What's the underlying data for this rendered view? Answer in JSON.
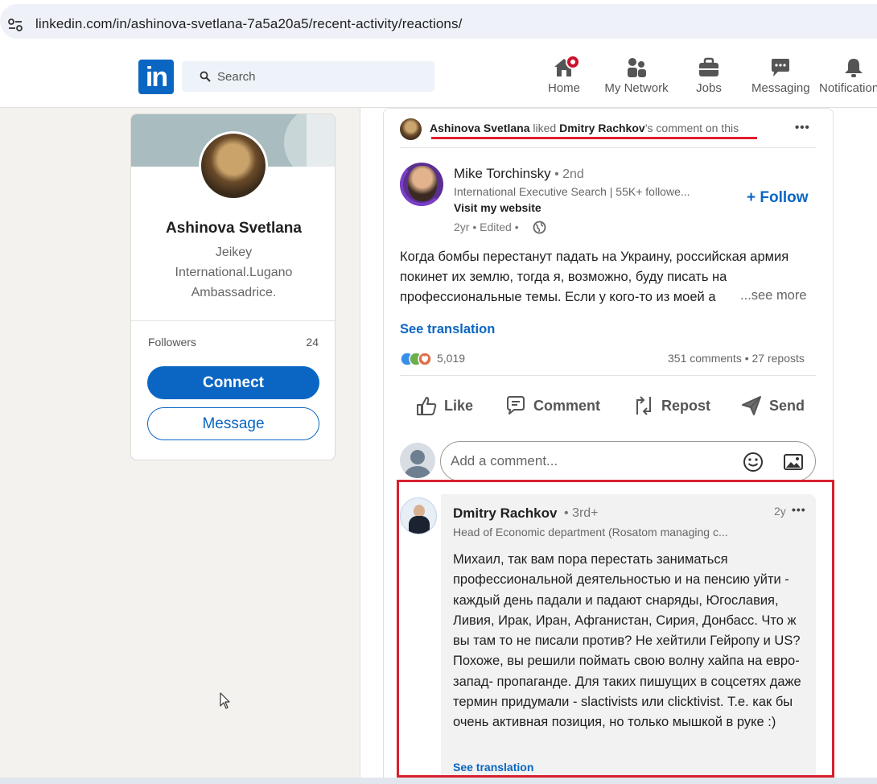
{
  "browser": {
    "url": "linkedin.com/in/ashinova-svetlana-7a5a20a5/recent-activity/reactions/"
  },
  "header": {
    "logo_text": "in",
    "search_placeholder": "Search",
    "nav": [
      {
        "label": "Home",
        "icon": "home-icon"
      },
      {
        "label": "My Network",
        "icon": "network-icon"
      },
      {
        "label": "Jobs",
        "icon": "briefcase-icon"
      },
      {
        "label": "Messaging",
        "icon": "messaging-icon"
      },
      {
        "label": "Notifications",
        "icon": "bell-icon"
      }
    ]
  },
  "profile": {
    "name": "Ashinova Svetlana",
    "headline": "Jeikey International.Lugano Ambassadrice.",
    "followers_label": "Followers",
    "followers_count": "24",
    "connect_label": "Connect",
    "message_label": "Message"
  },
  "activity": {
    "actor": "Ashinova Svetlana",
    "verb": " liked ",
    "target": "Dmitry Rachkov",
    "suffix": "’s comment on this",
    "menu": "•••"
  },
  "post": {
    "author_name": "Mike Torchinsky",
    "author_degree": " • 2nd",
    "author_headline": "International Executive Search | 55K+ followe...",
    "author_link": "Visit my website",
    "meta": "2yr • Edited •",
    "follow_label": "+ Follow",
    "text": "Когда бомбы перестанут падать на Украину, российская армия покинет их землю, тогда я, возможно, буду писать на профессиональные темы. Если у кого-то из моей а",
    "see_more": "...see more",
    "see_translation": "See translation",
    "reactions_count": "5,019",
    "stats": "351 comments • 27 reposts",
    "actions": {
      "like": "Like",
      "comment": "Comment",
      "repost": "Repost",
      "send": "Send"
    },
    "comment_placeholder": "Add a comment..."
  },
  "comment": {
    "author_name": "Dmitry Rachkov",
    "author_degree": "• 3rd+",
    "time": "2y",
    "menu": "•••",
    "headline": "Head of Economic department (Rosatom managing c...",
    "text": "Михаил, так вам пора перестать заниматься профессиональной деятельностью и на пенсию уйти - каждый день падали и падают снаряды, Югославия, Ливия, Ирак, Иран, Афганистан, Сирия, Донбасс. Что ж вы там то не писали против? Не хейтили Гейропу и US? Похоже, вы решили поймать свою волну хайпа на евро-запад- пропаганде. Для таких пишущих в соцсетях даже термин придумали - slactivists или clicktivist. Т.е. как бы очень активная позиция, но только мышкой в руке :)",
    "see_translation": "See translation"
  },
  "colors": {
    "brand": "#0a66c2",
    "highlight": "#d9202f",
    "badge": "#cb112d"
  }
}
